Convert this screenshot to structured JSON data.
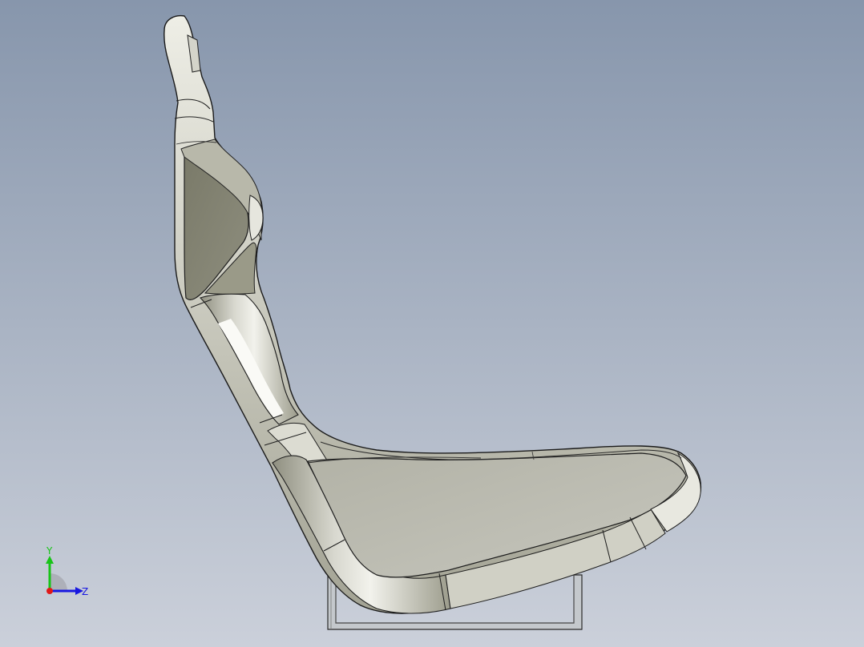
{
  "viewport": {
    "background_top": "#8a98ad",
    "background_bottom": "#c9ced8",
    "model_face_light": "#c3c3b8",
    "model_face_mid": "#a8a89a",
    "model_face_dark": "#7d7d6c",
    "model_edge": "#1c1c1c"
  },
  "triad": {
    "y_label": "Y",
    "z_label": "Z",
    "y_color": "#18c418",
    "z_color": "#1818e0",
    "x_color": "#e01818"
  }
}
